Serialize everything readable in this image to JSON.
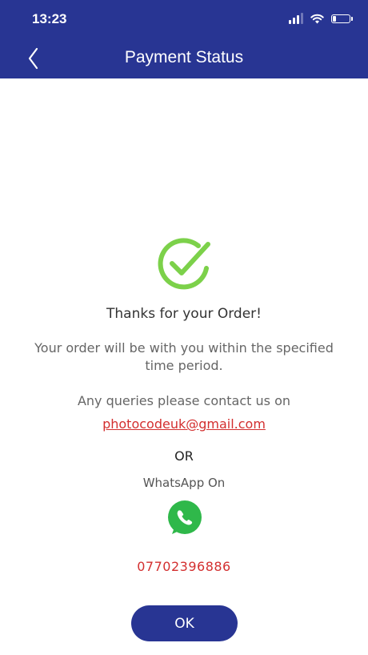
{
  "status_bar": {
    "time": "13:23"
  },
  "header": {
    "title": "Payment Status"
  },
  "main": {
    "heading": "Thanks for your Order!",
    "description": "Your order will be with you within the specified time period.",
    "contact_prompt": "Any queries please contact us on",
    "email": "photocodeuk@gmail.com",
    "or_label": "OR",
    "whatsapp_label": "WhatsApp On",
    "phone": "07702396886",
    "ok_label": "OK"
  },
  "colors": {
    "header_bg": "#283593",
    "success_green": "#7cd14a",
    "link_red": "#d32f2f",
    "whatsapp_green": "#2fb84a"
  },
  "icons": [
    "chevron-left-icon",
    "signal-icon",
    "wifi-icon",
    "battery-icon",
    "success-check-icon",
    "whatsapp-icon"
  ]
}
